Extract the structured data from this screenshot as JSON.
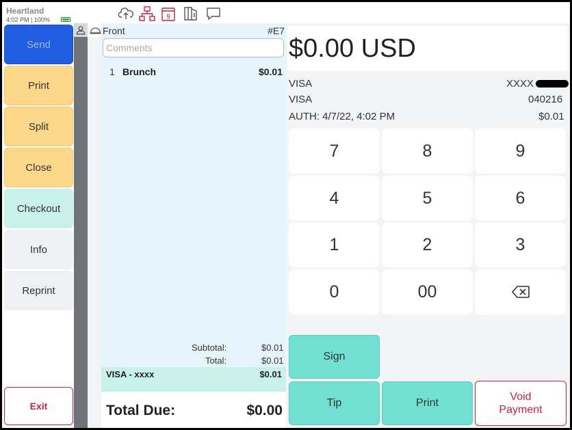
{
  "status": {
    "brand": "Heartland",
    "clock": "4:02 PM | 100%",
    "icons": [
      "cloud-upload-icon",
      "network-icon",
      "calendar-icon",
      "receipt-icon",
      "chat-icon"
    ],
    "calendar_day": "9"
  },
  "left_actions": {
    "send": "Send",
    "print": "Print",
    "split": "Split",
    "close": "Close",
    "checkout": "Checkout",
    "info": "Info",
    "reprint": "Reprint",
    "exit": "Exit"
  },
  "order": {
    "area": "Front",
    "check_number": "#E7",
    "comments_placeholder": "Comments",
    "items": [
      {
        "qty": "1",
        "name": "Brunch",
        "price": "$0.01"
      }
    ],
    "subtotal_label": "Subtotal:",
    "subtotal": "$0.01",
    "total_label": "Total:",
    "total": "$0.01",
    "payment_label": "VISA - xxxx",
    "payment_amount": "$0.01",
    "total_due_label": "Total Due:",
    "total_due": "$0.00"
  },
  "payment": {
    "amount": "$0.00 USD",
    "card_type_1": "VISA",
    "card_number": "XXXX",
    "card_type_2": "VISA",
    "auth_code": "040216",
    "auth_label": "AUTH: 4/7/22, 4:02 PM",
    "auth_amount": "$0.01"
  },
  "keypad": [
    "7",
    "8",
    "9",
    "4",
    "5",
    "6",
    "1",
    "2",
    "3",
    "0",
    "00"
  ],
  "actions": {
    "sign": "Sign",
    "tip": "Tip",
    "print": "Print",
    "void_line1": "Void",
    "void_line2": "Payment"
  },
  "colors": {
    "send": "#1f5ee0",
    "yellow": "#fdd88a",
    "teal": "#71e0d3",
    "danger": "#d2213c"
  }
}
